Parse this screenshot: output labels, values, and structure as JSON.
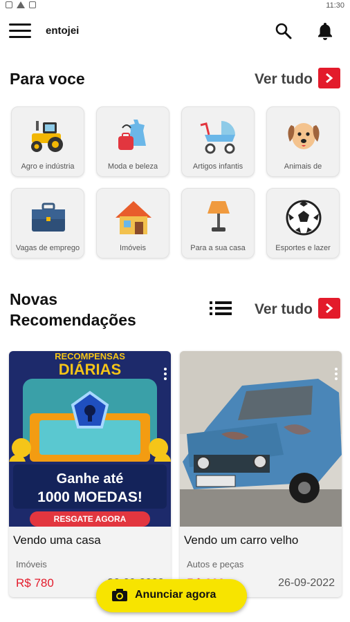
{
  "status_bar": {
    "time": "11:30"
  },
  "app_bar": {
    "title": "entojei"
  },
  "for_you": {
    "title": "Para voce",
    "see_all": "Ver tudo",
    "categories": [
      {
        "label": "Agro e indústria",
        "icon": "tractor-icon"
      },
      {
        "label": "Moda e beleza",
        "icon": "fashion-icon"
      },
      {
        "label": "Artigos infantis",
        "icon": "stroller-icon"
      },
      {
        "label": "Animais de",
        "icon": "dog-icon"
      },
      {
        "label": "Vagas de emprego",
        "icon": "briefcase-icon"
      },
      {
        "label": "Imóveis",
        "icon": "house-icon"
      },
      {
        "label": "Para a sua casa",
        "icon": "lamp-icon"
      },
      {
        "label": "Esportes e lazer",
        "icon": "soccer-ball-icon"
      }
    ]
  },
  "recommendations": {
    "title_line1": "Novas",
    "title_line2": "Recomendações",
    "see_all": "Ver tudo",
    "items": [
      {
        "title": "Vendo uma casa",
        "category": "Imóveis",
        "price": "R$ 780",
        "date": "26-09-2022",
        "banner_top": "RECOMPENSAS",
        "banner_mid": "DIÁRIAS",
        "banner_line1": "Ganhe até",
        "banner_line2": "1000 MOEDAS!",
        "banner_button": "RESGATE AGORA"
      },
      {
        "title": "Vendo um carro velho",
        "category": "Autos e peças",
        "price": "R$ 888",
        "date": "26-09-2022"
      }
    ]
  },
  "fab": {
    "label": "Anunciar agora"
  },
  "colors": {
    "accent": "#e31b2b",
    "fab": "#f7e400"
  }
}
